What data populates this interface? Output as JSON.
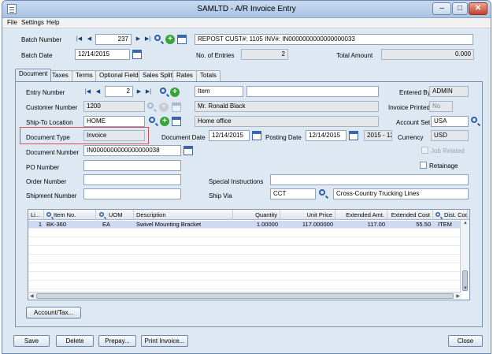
{
  "window": {
    "title": "SAMLTD - A/R Invoice Entry",
    "min": "–",
    "max": "□",
    "close": "✕"
  },
  "menu": {
    "file": "File",
    "settings": "Settings",
    "help": "Help"
  },
  "batch": {
    "number_label": "Batch Number",
    "number": "237",
    "description": "REPOST CUST#: 1105 INV#: IN0000000000000000033",
    "date_label": "Batch Date",
    "date": "12/14/2015",
    "entries_label": "No. of Entries",
    "entries": "2",
    "total_label": "Total Amount",
    "total": "0.000"
  },
  "tabs": [
    "Document",
    "Taxes",
    "Terms",
    "Optional Fields",
    "Sales Split",
    "Rates",
    "Totals"
  ],
  "document": {
    "entry_number_label": "Entry Number",
    "entry_number": "2",
    "item_label_field": "Item",
    "entered_by_label": "Entered By",
    "entered_by": "ADMIN",
    "customer_number_label": "Customer Number",
    "customer_number": "1200",
    "customer_name": "Mr. Ronald Black",
    "invoice_printed_label": "Invoice Printed",
    "invoice_printed": "No",
    "ship_to_label": "Ship-To Location",
    "ship_to": "HOME",
    "ship_to_desc": "Home office",
    "account_set_label": "Account Set",
    "account_set": "USA",
    "doc_type_label": "Document Type",
    "doc_type": "Invoice",
    "doc_date_label": "Document Date",
    "doc_date": "12/14/2015",
    "posting_date_label": "Posting Date",
    "posting_date": "12/14/2015",
    "period": "2015 - 12",
    "currency_label": "Currency",
    "currency": "USD",
    "doc_number_label": "Document Number",
    "doc_number": "IN0000000000000000038",
    "job_related_label": "Job Related",
    "po_number_label": "PO Number",
    "retainage_label": "Retainage",
    "order_number_label": "Order Number",
    "special_instr_label": "Special Instructions",
    "shipment_number_label": "Shipment Number",
    "ship_via_label": "Ship Via",
    "ship_via": "CCT",
    "ship_via_desc": "Cross-Country Trucking Lines"
  },
  "grid": {
    "headers": [
      "Li...",
      "Item No.",
      "UOM",
      "Description",
      "Quantity",
      "Unit Price",
      "Extended Amt.",
      "Extended Cost",
      "Dist. Code",
      "I"
    ],
    "rows": [
      [
        "1",
        "BK-360",
        "EA",
        "Swivel Mounting Bracket",
        "1.00000",
        "117.000000",
        "117.00",
        "55.50",
        "ITEM",
        "N"
      ]
    ]
  },
  "buttons": {
    "account_tax": "Account/Tax...",
    "save": "Save",
    "delete": "Delete",
    "prepay": "Prepay...",
    "print_invoice": "Print Invoice...",
    "close": "Close"
  }
}
